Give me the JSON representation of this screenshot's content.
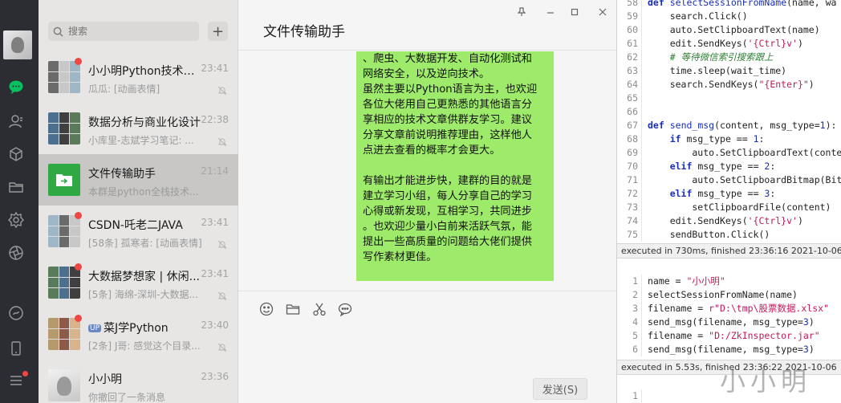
{
  "search": {
    "placeholder": "搜索"
  },
  "chats": [
    {
      "name": "小小明Python技术交...",
      "time": "23:41",
      "preview": "瓜瓜: [动画表情]",
      "unread": true,
      "muted": true,
      "avatar": "group"
    },
    {
      "name": "数据分析与商业化设计",
      "time": "22:38",
      "preview": "小库里-志斌学习笔记: ...",
      "unread": false,
      "muted": true,
      "avatar": "group"
    },
    {
      "name": "文件传输助手",
      "time": "21:14",
      "preview": "本群是python全栈技术...",
      "unread": false,
      "muted": false,
      "avatar": "file",
      "active": true
    },
    {
      "name": "CSDN-吒老二JAVA",
      "time": "23:41",
      "preview": "[58条] 孤寒者: [动画表情]",
      "unread": true,
      "muted": true,
      "avatar": "group"
    },
    {
      "name": "大数据梦想家 | 休闲...",
      "time": "23:41",
      "preview": "[5条] 海绵-深圳-大数据...",
      "unread": true,
      "muted": true,
      "avatar": "group"
    },
    {
      "name": "菜J学Python",
      "time": "23:40",
      "preview": "[2条] J哥: 感觉这个目录...",
      "unread": true,
      "muted": true,
      "avatar": "group",
      "badge": "UP"
    },
    {
      "name": "小小明",
      "time": "23:36",
      "preview": "你撤回了一条消息",
      "unread": false,
      "muted": false,
      "avatar": "single"
    }
  ],
  "chat_window": {
    "title": "文件传输助手",
    "bubble_lines": [
      "、爬虫、大数据开发、自动化测试和",
      "网络安全，以及逆向技术。",
      "虽然主要以Python语言为主，也欢迎",
      "各位大佬用自己更熟悉的其他语言分",
      "享相应的技术文章供群友学习。建议",
      "分享文章前说明推荐理由，这样他人",
      "点进去查看的概率才会更大。",
      "",
      "有输出才能进步快，建群的目的就是",
      "建立学习小组，每人分享自己的学习",
      "心得或新发现，互相学习，共同进步",
      "。也欢迎少量小白前来活跃气氛，能",
      "提出一些高质量的问题给大佬们提供",
      "写作素材更佳。"
    ],
    "send_label": "发送(S)"
  },
  "editor": {
    "block1_lines": [
      "58",
      "59",
      "60",
      "61",
      "62",
      "63",
      "64",
      "65",
      "66",
      "67",
      "68",
      "69",
      "70",
      "71",
      "72",
      "73",
      "74",
      "75"
    ],
    "block1_code": [
      "def selectSessionFromName(name, wa",
      "    search.Click()",
      "    auto.SetClipboardText(name)",
      "    edit.SendKeys('{Ctrl}v')",
      "    # 等待微信索引搜索跟上",
      "    time.sleep(wait_time)",
      "    search.SendKeys(\"{Enter}\")",
      "",
      "",
      "def send_msg(content, msg_type=1):",
      "    if msg_type == 1:",
      "        auto.SetClipboardText(conte",
      "    elif msg_type == 2:",
      "        auto.SetClipboardBitmap(Bit",
      "    elif msg_type == 3:",
      "        setClipboardFile(content)",
      "    edit.SendKeys('{Ctrl}v')",
      "    sendButton.Click()"
    ],
    "status1": "executed in 730ms, finished 23:36:16 2021-10-06",
    "block2_lines": [
      "1",
      "2",
      "3",
      "4",
      "5",
      "6"
    ],
    "block2_code": [
      "name = \"小小明\"",
      "selectSessionFromName(name)",
      "filename = r\"D:\\tmp\\股票数据.xlsx\"",
      "send_msg(filename, msg_type=3)",
      "filename = \"D:/ZkInspector.jar\"",
      "send_msg(filename, msg_type=3)"
    ],
    "status2": "executed in 5.53s, finished 23:36:22 2021-10-06",
    "block3_lines": [
      "1"
    ]
  },
  "watermark": "小小明",
  "colors": {
    "rail": "#2b2d33",
    "list": "#e7e6e5",
    "active": "#c8c7c6",
    "bubble": "#9eea6a",
    "accent": "#07c160",
    "unread": "#f04646"
  },
  "icons": {
    "rail": [
      "chat-icon",
      "contacts-icon",
      "cube-icon",
      "folder-icon",
      "moments-icon",
      "aperture-icon",
      "mini-program-icon",
      "phone-icon",
      "menu-icon"
    ],
    "toolbar": [
      "emoji-icon",
      "folder-icon",
      "scissors-icon",
      "chat-history-icon"
    ]
  }
}
